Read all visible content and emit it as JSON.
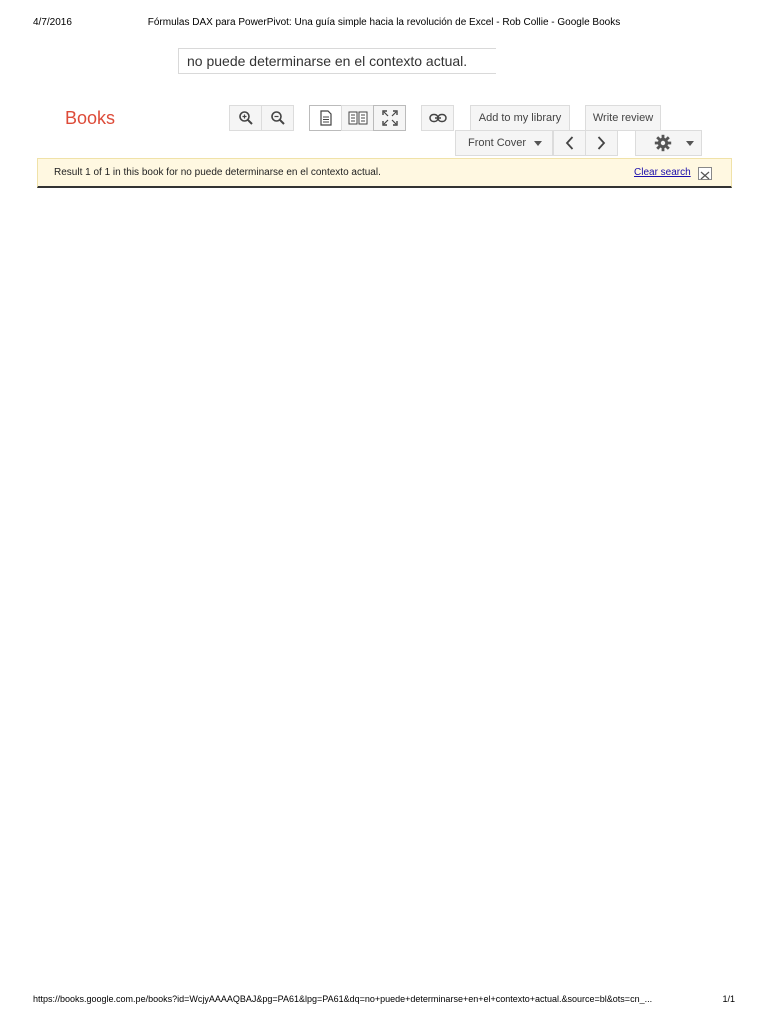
{
  "print_header": {
    "date": "4/7/2016",
    "title": "Fórmulas DAX para PowerPivot: Una guía simple hacia la revolución de Excel - Rob Collie - Google Books"
  },
  "search": {
    "query": "no puede determinarse en el contexto actual."
  },
  "logo": {
    "text": "Books",
    "color": "#dd4b39"
  },
  "toolbar": {
    "zoom_in": "zoom-in-icon",
    "zoom_out": "zoom-out-icon",
    "single_page": "single-page-icon",
    "two_page": "two-page-icon",
    "fullscreen": "fullscreen-icon",
    "link": "link-icon",
    "add_library_label": "Add to my library",
    "write_review_label": "Write review",
    "front_cover_label": "Front Cover",
    "settings": "gear-icon"
  },
  "result_bar": {
    "text": "Result 1 of 1 in this book for no puede determinarse en el contexto actual.",
    "clear_label": "Clear search"
  },
  "print_footer": {
    "url": "https://books.google.com.pe/books?id=WcjyAAAAQBAJ&pg=PA61&lpg=PA61&dq=no+puede+determinarse+en+el+contexto+actual.&source=bl&ots=cn_...",
    "page": "1/1"
  }
}
